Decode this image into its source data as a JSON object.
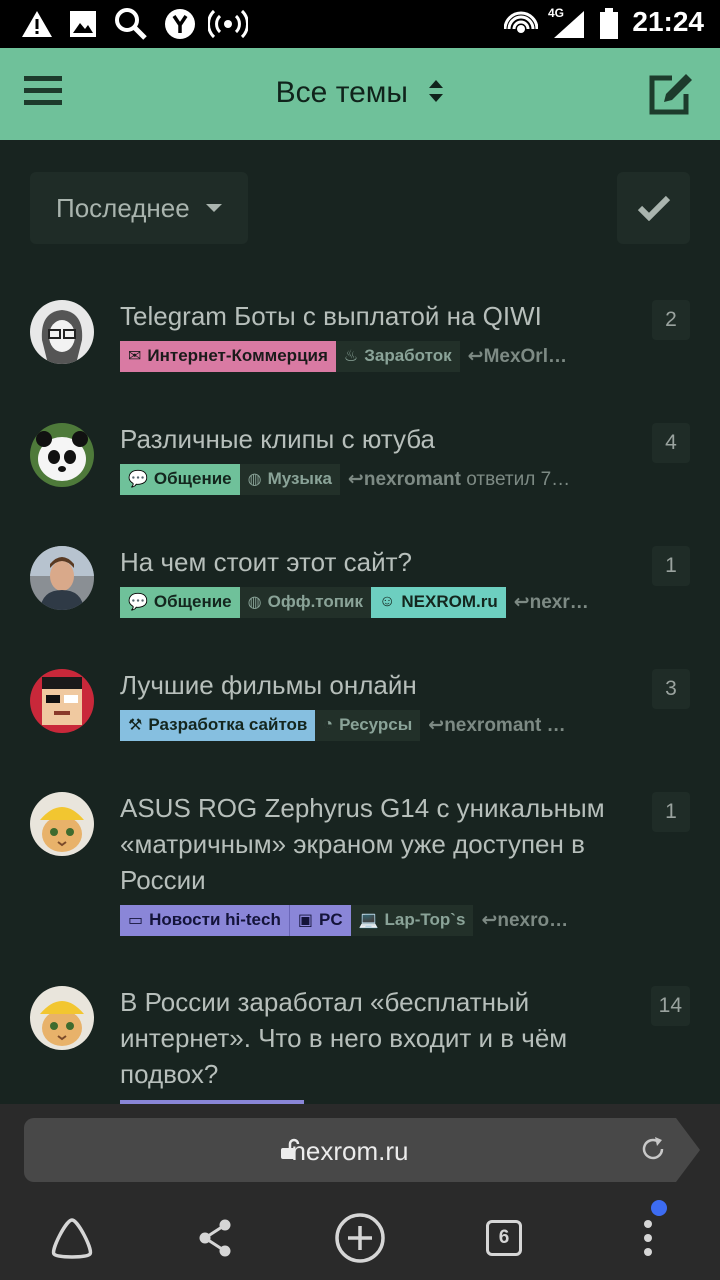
{
  "status_bar": {
    "time": "21:24",
    "network": "4G"
  },
  "header": {
    "title": "Все темы"
  },
  "filters": {
    "sort_label": "Последнее"
  },
  "topics": [
    {
      "title": "Telegram Боты с выплатой на QIWI",
      "replies": "2",
      "tags": [
        {
          "label": "Интернет-Коммерция",
          "bg": "#d97aa3",
          "fg": "#1b1b1b",
          "icon": "ticket-icon"
        },
        {
          "label": "Заработок",
          "bg": "#223029",
          "fg": "#8aa398",
          "icon": "coin-hand-icon"
        }
      ],
      "last_user": "MexOrl…",
      "last_text": ""
    },
    {
      "title": "Различные клипы с ютуба",
      "replies": "4",
      "tags": [
        {
          "label": "Общение",
          "bg": "#6fc19a",
          "fg": "#14261e",
          "icon": "comments-icon"
        },
        {
          "label": "Музыка",
          "bg": "#223029",
          "fg": "#8aa398",
          "icon": "comment-icon"
        }
      ],
      "last_user": "nexromant",
      "last_text": "ответил 7…"
    },
    {
      "title": "На чем стоит этот сайт?",
      "replies": "1",
      "tags": [
        {
          "label": "Общение",
          "bg": "#6fc19a",
          "fg": "#14261e",
          "icon": "comments-icon"
        },
        {
          "label": "Офф.топик",
          "bg": "#223029",
          "fg": "#8aa398",
          "icon": "comment-icon"
        },
        {
          "label": "NEXROM.ru",
          "bg": "#6dcfc0",
          "fg": "#14261e",
          "icon": "user-icon"
        }
      ],
      "last_user": "nexr…",
      "last_text": ""
    },
    {
      "title": "Лучшие фильмы онлайн",
      "replies": "3",
      "tags": [
        {
          "label": "Разработка сайтов",
          "bg": "#86bfe0",
          "fg": "#14261e",
          "icon": "hammer-icon"
        },
        {
          "label": "Ресурсы",
          "bg": "#223029",
          "fg": "#8aa398",
          "icon": "signal-icon"
        }
      ],
      "last_user": "nexromant …",
      "last_text": ""
    },
    {
      "title": "ASUS ROG Zephyrus G14 с уникальным «матричным» экраном уже доступен в России",
      "replies": "1",
      "tags": [
        {
          "label": "Новости hi-tech",
          "bg": "#8a86d8",
          "fg": "#14143a",
          "icon": "devices-icon"
        },
        {
          "label": "PC",
          "bg": "#8a86d8",
          "fg": "#14143a",
          "icon": "pc-icon"
        },
        {
          "label": "Lap-Top`s",
          "bg": "#223029",
          "fg": "#8aa398",
          "icon": "laptop-icon"
        }
      ],
      "last_user": "nexro…",
      "last_text": ""
    },
    {
      "title": "В России заработал «бесплатный интернет». Что в него входит и в чём подвох?",
      "replies": "14",
      "tags": [],
      "last_user": "",
      "last_text": ""
    }
  ],
  "browser": {
    "url": "nexrom.ru",
    "tab_count": "6"
  }
}
